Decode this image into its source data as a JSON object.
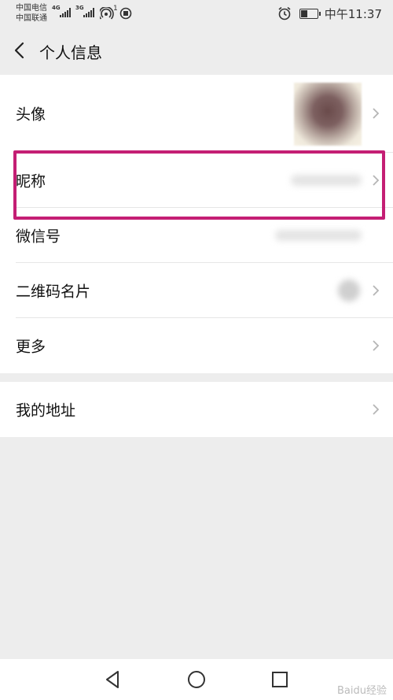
{
  "status_bar": {
    "carrier_1": "中国电信",
    "carrier_2": "中国联通",
    "signal_1_label": "4G",
    "signal_2_label": "3G",
    "hotspot_badge": "1",
    "time": "中午11:37",
    "battery_level": 0.4
  },
  "nav": {
    "title": "个人信息"
  },
  "profile": {
    "rows": [
      {
        "label": "头像"
      },
      {
        "label": "昵称"
      },
      {
        "label": "微信号"
      },
      {
        "label": "二维码名片"
      },
      {
        "label": "更多"
      }
    ]
  },
  "address": {
    "label": "我的地址"
  },
  "watermark": "Baidu经验",
  "colors": {
    "highlight": "#c41e74",
    "background": "#ededed"
  }
}
